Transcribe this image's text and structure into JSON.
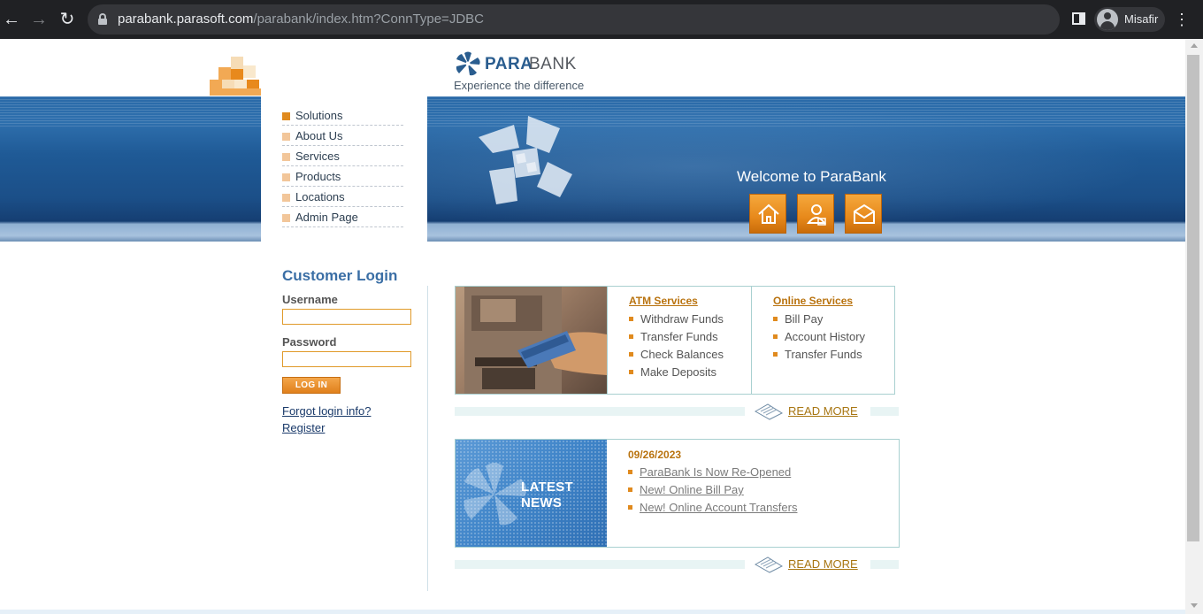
{
  "browser": {
    "url_host": "parabank.parasoft.com",
    "url_path": "/parabank/index.htm?ConnType=JDBC",
    "profile_name": "Misafir",
    "icons": [
      "back-arrow-icon",
      "forward-arrow-icon",
      "reload-icon",
      "lock-icon",
      "side-panel-icon",
      "profile-avatar-icon",
      "more-menu-icon"
    ]
  },
  "header": {
    "logo_para": "PARA",
    "logo_bank": "BANK",
    "tagline": "Experience the difference"
  },
  "menu": {
    "items": [
      {
        "label": "Solutions"
      },
      {
        "label": "About Us"
      },
      {
        "label": "Services"
      },
      {
        "label": "Products"
      },
      {
        "label": "Locations"
      },
      {
        "label": "Admin Page"
      }
    ]
  },
  "banner": {
    "welcome": "Welcome to ParaBank",
    "buttons": [
      "home-icon",
      "about-icon",
      "contact-icon"
    ]
  },
  "login": {
    "title": "Customer Login",
    "username_label": "Username",
    "username_value": "",
    "password_label": "Password",
    "password_value": "",
    "button_label": "LOG IN",
    "forgot_link": "Forgot login info?",
    "register_link": "Register"
  },
  "services": {
    "atm": {
      "heading": "ATM Services",
      "items": [
        "Withdraw Funds",
        "Transfer Funds",
        "Check Balances",
        "Make Deposits"
      ]
    },
    "online": {
      "heading": "Online Services",
      "items": [
        "Bill Pay",
        "Account History",
        "Transfer Funds"
      ]
    },
    "read_more": "READ MORE"
  },
  "news": {
    "image_text_line1": "LATEST",
    "image_text_line2": "NEWS",
    "date": "09/26/2023",
    "items": [
      "ParaBank Is Now Re-Opened",
      "New! Online Bill Pay",
      "New! Online Account Transfers"
    ],
    "read_more": "READ MORE"
  },
  "colors": {
    "accent_orange": "#e08a1e",
    "link_gold": "#b9730f",
    "banner_blue": "#1f5a96",
    "title_blue": "#3a6ea5"
  }
}
